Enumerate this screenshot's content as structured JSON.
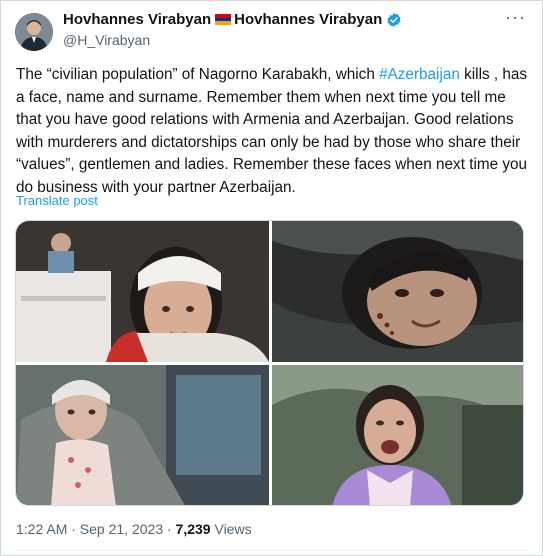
{
  "author": {
    "name_part1": "Hovhannes Virabyan",
    "name_part2": "Hovhannes Virabyan",
    "handle": "@H_Virabyan",
    "flag_colors": [
      "#d90012",
      "#0033a0",
      "#f2a800"
    ],
    "verified_color": "#1d9bf0"
  },
  "more_icon": "more-horizontal-icon",
  "tweet": {
    "text_before": "The “civilian population” of Nagorno Karabakh, which ",
    "hashtag": "#Azerbaijan",
    "text_after": " kills , has a face, name and surname. Remember them when next time you tell me that you have good relations with Armenia and Azerbaijan. Good relations with murderers and dictatorships can only be had by those who share their “values”, gentlemen and ladies. Remember these faces when next time you do business with your partner Azerbaijan.",
    "translate_label": "Translate post"
  },
  "meta": {
    "time_date": "1:22 AM · Sep 21, 2023 · ",
    "views_count": "7,239",
    "views_label": " Views"
  }
}
